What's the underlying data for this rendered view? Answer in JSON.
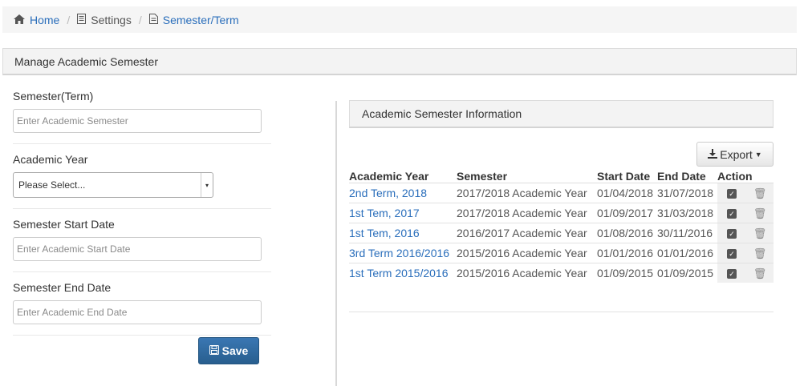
{
  "breadcrumb": {
    "home": "Home",
    "settings": "Settings",
    "current": "Semester/Term",
    "separator": "/"
  },
  "panel": {
    "title": "Manage Academic Semester"
  },
  "form": {
    "semester_label": "Semester(Term)",
    "semester_placeholder": "Enter Academic Semester",
    "year_label": "Academic Year",
    "year_selected": "Please Select...",
    "start_label": "Semester Start Date",
    "start_placeholder": "Enter Academic Start Date",
    "end_label": "Semester End Date",
    "end_placeholder": "Enter Academic End Date",
    "save_label": "Save"
  },
  "info": {
    "title": "Academic Semester Information",
    "export_label": "Export",
    "columns": [
      "Academic Year",
      "Semester",
      "Start Date",
      "End Date",
      "Action"
    ],
    "rows": [
      [
        "2nd Term, 2018",
        "2017/2018 Academic Year",
        "01/04/2018",
        "31/07/2018"
      ],
      [
        "1st Tem, 2017",
        "2017/2018 Academic Year",
        "01/09/2017",
        "31/03/2018"
      ],
      [
        "1st Tem, 2016",
        "2016/2017 Academic Year",
        "01/08/2016",
        "30/11/2016"
      ],
      [
        "3rd Term 2016/2016",
        "2015/2016 Academic Year",
        "01/01/2016",
        "01/01/2016"
      ],
      [
        "1st Term 2015/2016",
        "2015/2016 Academic Year",
        "01/09/2015",
        "01/09/2015"
      ]
    ]
  },
  "icons": {
    "home": "home-icon",
    "settings": "document-icon",
    "current": "document-icon",
    "save": "floppy-icon",
    "export": "download-icon",
    "edit": "checkbox-icon",
    "delete": "trash-icon"
  },
  "colors": {
    "link": "#2a6ebb",
    "primary_button": "#285e8e"
  }
}
